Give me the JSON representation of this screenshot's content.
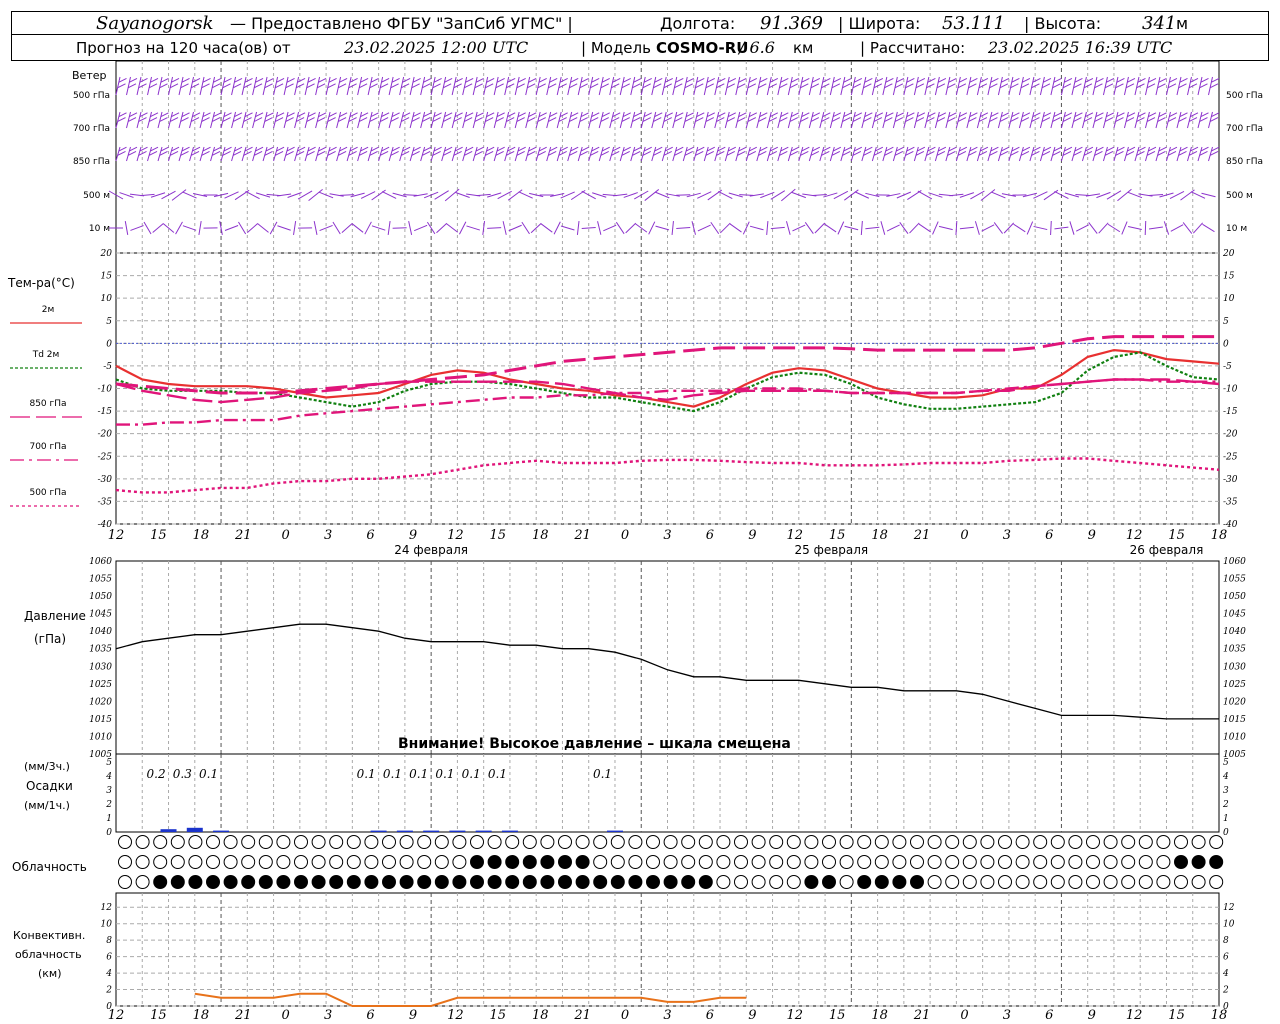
{
  "header": {
    "station": "Sayanogorsk",
    "provider": "— Предоставлено ФГБУ \"ЗапСиб УГМС\" |",
    "lon_label": "Долгота:",
    "lon_value": "91.369",
    "lat_label": "| Широта:",
    "lat_value": "53.111",
    "alt_label": "| Высота:",
    "alt_value": "341",
    "alt_unit": "м",
    "forecast_prefix": "Прогноз на 120 часа(ов) от",
    "forecast_start": "23.02.2025 12:00 UTC",
    "model_label": "| Модель",
    "model_name": "COSMO-RU",
    "model_res": "/ 6.6",
    "model_res_unit": "км",
    "computed_label": "| Рассчитано:",
    "computed_time": "23.02.2025 16:39 UTC"
  },
  "colors": {
    "wind": "#8c33cc",
    "temp2m": "#e83030",
    "td2m": "#108010",
    "t850": "#e0157a",
    "pressure": "#000000",
    "precip": "#1a33cc",
    "conv": "#e8721a",
    "zero_line": "#3344cc"
  },
  "chart_data": [
    {
      "id": "wind",
      "type": "other",
      "title": "Ветер",
      "levels": [
        "500 гПа",
        "700 гПа",
        "850 гПа",
        "500 м",
        "10 м"
      ],
      "marker": "wind barbs"
    },
    {
      "id": "temperature",
      "type": "line",
      "ylabel": "Тем-ра(°C)",
      "ylim": [
        -40,
        20
      ],
      "yticks": [
        20,
        15,
        10,
        5,
        0,
        -5,
        -10,
        -15,
        -20,
        -25,
        -30,
        -35,
        -40
      ],
      "x": [
        0,
        3,
        6,
        9,
        12,
        15,
        18,
        21,
        24,
        27,
        30,
        33,
        36,
        39,
        42,
        45,
        48,
        51,
        54,
        57,
        60,
        63,
        66,
        69,
        72,
        75,
        78,
        81,
        84,
        87,
        90,
        93,
        96,
        99,
        102,
        105,
        108,
        111,
        114,
        117,
        120,
        123,
        126
      ],
      "x_labels": [
        "12",
        "15",
        "18",
        "21",
        "0",
        "3",
        "6",
        "9",
        "12",
        "15",
        "18",
        "21",
        "0",
        "3",
        "6",
        "9",
        "12",
        "15",
        "18",
        "21",
        "0",
        "3",
        "6",
        "9",
        "12",
        "15",
        "18"
      ],
      "date_labels": [
        "24 февраля",
        "25 февраля",
        "26 февраля"
      ],
      "series": [
        {
          "name": "2м",
          "values": [
            -5,
            -8,
            -9,
            -9.5,
            -9.5,
            -9.5,
            -10,
            -11,
            -12,
            -11.5,
            -11,
            -9,
            -7,
            -6,
            -6.5,
            -8,
            -9,
            -10,
            -10.5,
            -11.5,
            -12,
            -13,
            -14,
            -12,
            -9,
            -6.5,
            -5.5,
            -6,
            -8,
            -10,
            -11,
            -12,
            -12,
            -11.5,
            -10,
            -10,
            -7,
            -3,
            -1.5,
            -2,
            -3.5,
            -4,
            -4.5
          ]
        },
        {
          "name": "Td 2м",
          "values": [
            -8,
            -10,
            -10.5,
            -10.5,
            -10.5,
            -11,
            -11,
            -12,
            -13,
            -14,
            -13,
            -10.5,
            -9,
            -8.5,
            -8.5,
            -9,
            -10,
            -11,
            -12,
            -12,
            -13,
            -14,
            -15,
            -13,
            -10,
            -7.5,
            -6.5,
            -7,
            -9,
            -12,
            -13.5,
            -14.5,
            -14.5,
            -14,
            -13.5,
            -13,
            -11,
            -6,
            -3,
            -2,
            -5,
            -7.5,
            -8
          ]
        },
        {
          "name": "850 гПа",
          "values": [
            -9,
            -10.5,
            -11.5,
            -12.5,
            -13,
            -12.5,
            -12,
            -11,
            -10.5,
            -10,
            -9,
            -8.5,
            -8.5,
            -8.5,
            -8.5,
            -8.5,
            -8.5,
            -9,
            -10,
            -11,
            -12,
            -12.5,
            -11.5,
            -11,
            -10.5,
            -10.5,
            -10.5,
            -10.5,
            -11,
            -11,
            -11,
            -11,
            -11,
            -10.5,
            -10.5,
            -9.5,
            -9,
            -8.5,
            -8,
            -8,
            -8,
            -8.5,
            -9
          ]
        },
        {
          "name": "700 гПа",
          "values": [
            -18,
            -18,
            -17.5,
            -17.5,
            -17,
            -17,
            -17,
            -16,
            -15.5,
            -15,
            -14.5,
            -14,
            -13.5,
            -13,
            -12.5,
            -12,
            -12,
            -11.5,
            -11.5,
            -11,
            -11,
            -10.5,
            -10.5,
            -10.5,
            -10,
            -10,
            -10,
            -10.5,
            -11,
            -11,
            -11,
            -11,
            -11,
            -10.5,
            -10,
            -9.5,
            -9,
            -8.5,
            -8,
            -8,
            -8.5,
            -8.5,
            -8.5
          ]
        },
        {
          "name": "500 гПа",
          "values": [
            -32.5,
            -33,
            -33,
            -32.5,
            -32,
            -32,
            -31,
            -30.5,
            -30.5,
            -30,
            -30,
            -29.5,
            -29,
            -28,
            -27,
            -26.5,
            -26,
            -26.5,
            -26.5,
            -26.5,
            -26,
            -25.8,
            -25.8,
            -26,
            -26.3,
            -26.5,
            -26.5,
            -27,
            -27,
            -27,
            -26.8,
            -26.5,
            -26.5,
            -26.5,
            -26,
            -25.8,
            -25.5,
            -25.5,
            -26,
            -26.5,
            -27,
            -27.5,
            -28
          ]
        },
        {
          "name": "0",
          "values": [
            0,
            0,
            0,
            0,
            0,
            0,
            0,
            0,
            0,
            0,
            0,
            0,
            0,
            0,
            0,
            0,
            0,
            0,
            0,
            0,
            0,
            0,
            0,
            0,
            0,
            0,
            0,
            0,
            0,
            0,
            0,
            0,
            0,
            0,
            0,
            0,
            0,
            0,
            0,
            0,
            0,
            0,
            0
          ]
        },
        {
          "name": "тренд",
          "values": [
            -9,
            -9.5,
            -10,
            -10.5,
            -11,
            -11,
            -11,
            -10.5,
            -10,
            -9.5,
            -9,
            -8.5,
            -8,
            -7.5,
            -7,
            -6,
            -5,
            -4,
            -3.5,
            -3,
            -2.5,
            -2,
            -1.5,
            -1,
            -1,
            -1,
            -1,
            -1,
            -1.2,
            -1.5,
            -1.5,
            -1.5,
            -1.5,
            -1.5,
            -1.5,
            -1,
            0,
            1,
            1.5,
            1.5,
            1.5,
            1.5,
            1.5
          ]
        }
      ]
    },
    {
      "id": "pressure",
      "type": "line",
      "ylabel": "Давление",
      "yunit": "(гПа)",
      "ylim": [
        1005,
        1060
      ],
      "yticks": [
        1060,
        1055,
        1050,
        1045,
        1040,
        1035,
        1030,
        1025,
        1020,
        1015,
        1010,
        1005
      ],
      "x": [
        0,
        3,
        6,
        9,
        12,
        15,
        18,
        21,
        24,
        27,
        30,
        33,
        36,
        39,
        42,
        45,
        48,
        51,
        54,
        57,
        60,
        63,
        66,
        69,
        72,
        75,
        78,
        81,
        84,
        87,
        90,
        93,
        96,
        99,
        102,
        105,
        108,
        111,
        114,
        117,
        120,
        123,
        126
      ],
      "values": [
        1035,
        1037,
        1038,
        1039,
        1039,
        1040,
        1041,
        1042,
        1042,
        1041,
        1040,
        1038,
        1037,
        1037,
        1037,
        1036,
        1036,
        1035,
        1035,
        1034,
        1032,
        1029,
        1027,
        1027,
        1026,
        1026,
        1026,
        1025,
        1024,
        1024,
        1023,
        1023,
        1023,
        1022,
        1020,
        1018,
        1016,
        1016,
        1016,
        1015.5,
        1015,
        1015,
        1015
      ],
      "warning": "Внимание! Высокое давление – шкала смещена"
    },
    {
      "id": "precipitation",
      "type": "bar",
      "ylabel": "Осадки",
      "yunit_top": "(мм/3ч.)",
      "yunit_bottom": "(мм/1ч.)",
      "ylim": [
        0,
        5
      ],
      "yticks": [
        5,
        4,
        3,
        2,
        1,
        0
      ],
      "x": [
        6,
        9,
        12,
        15,
        18,
        21,
        24,
        27,
        30,
        33,
        36,
        39,
        42,
        45,
        48,
        51,
        54,
        57,
        60,
        63,
        66,
        69,
        72
      ],
      "values": [
        0.2,
        0.3,
        0.1,
        0,
        0,
        0,
        0,
        0,
        0.1,
        0.1,
        0.1,
        0.1,
        0.1,
        0.1,
        0,
        0,
        0,
        0.1,
        0,
        0,
        0,
        0,
        0
      ],
      "labels": [
        "0.2",
        "0.3",
        "0.1",
        "0.1",
        "0.1",
        "0.1",
        "0.1",
        "0.1",
        "0.1",
        "0.1"
      ]
    },
    {
      "id": "cloudiness",
      "type": "other",
      "title": "Облачность",
      "rows": 3
    },
    {
      "id": "convective",
      "type": "area",
      "ylabel_lines": [
        "Конвективн.",
        "облачность",
        "(км)"
      ],
      "ylim": [
        0,
        13
      ],
      "yticks": [
        12,
        10,
        8,
        6,
        4,
        2,
        0
      ],
      "x": [
        9,
        12,
        15,
        18,
        21,
        24,
        27,
        30,
        33,
        36,
        39,
        42,
        45,
        48,
        51,
        54,
        57,
        60,
        63,
        66,
        69,
        72
      ],
      "values": [
        1.5,
        1,
        1,
        1,
        1.5,
        1.5,
        0,
        0,
        0,
        0,
        1,
        1,
        1,
        1,
        1,
        1,
        1,
        1,
        0.5,
        0.5,
        1,
        1
      ]
    }
  ]
}
